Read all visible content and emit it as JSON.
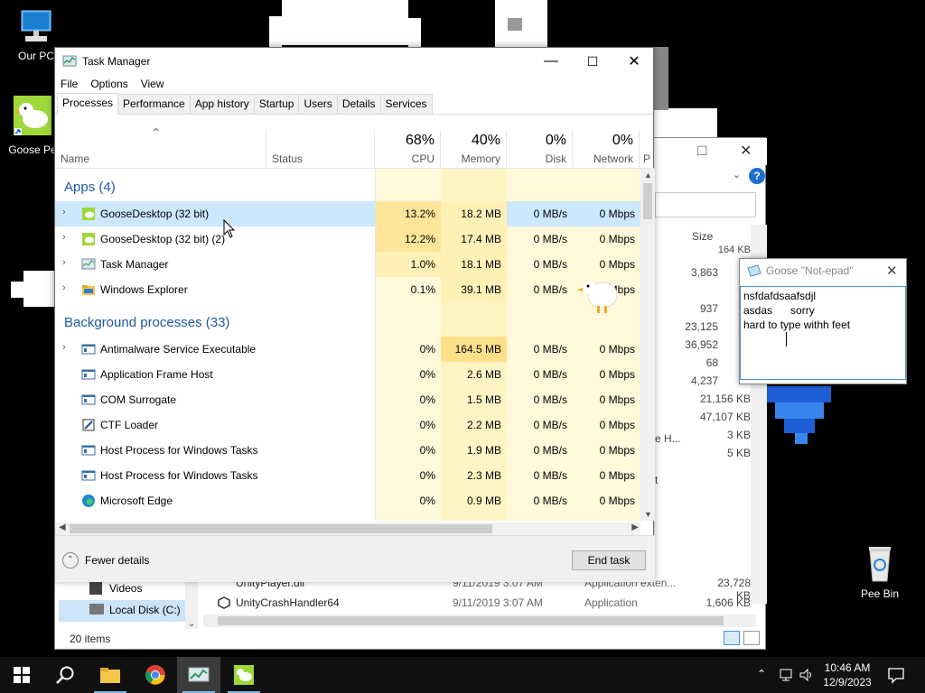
{
  "desktop": {
    "icons": [
      {
        "label": "Our PC"
      },
      {
        "label": "Goose Pe"
      },
      {
        "label": "Pee Bin"
      }
    ]
  },
  "explorer": {
    "size_header": "Size",
    "sizes": [
      "164 KB",
      "3,863",
      "937",
      "23,125",
      "36,952",
      "68",
      "4,237",
      "21,156 KB",
      "47,107 KB",
      "3 KB",
      "5 KB"
    ],
    "partial_texts": [
      "e H...",
      "t"
    ],
    "nav": [
      {
        "label": "Videos"
      },
      {
        "label": "Local Disk (C:)"
      }
    ],
    "files": [
      {
        "name": "UnityPlayer.dll",
        "date": "9/11/2019 3:07 AM",
        "type": "Application exten...",
        "size": "23,728 KB"
      },
      {
        "name": "UnityCrashHandler64",
        "date": "9/11/2019 3:07 AM",
        "type": "Application",
        "size": "1,606 KB"
      }
    ],
    "status": "20 items"
  },
  "taskmanager": {
    "title": "Task Manager",
    "menu": [
      "File",
      "Options",
      "View"
    ],
    "tabs": [
      "Processes",
      "Performance",
      "App history",
      "Startup",
      "Users",
      "Details",
      "Services"
    ],
    "columns": {
      "name": "Name",
      "status": "Status",
      "cpu": {
        "pct": "68%",
        "label": "CPU"
      },
      "memory": {
        "pct": "40%",
        "label": "Memory"
      },
      "disk": {
        "pct": "0%",
        "label": "Disk"
      },
      "network": {
        "pct": "0%",
        "label": "Network"
      },
      "extra": "P"
    },
    "apps_header": "Apps (4)",
    "apps": [
      {
        "name": "GooseDesktop (32 bit)",
        "cpu": "13.2%",
        "mem": "18.2 MB",
        "disk": "0 MB/s",
        "net": "0 Mbps"
      },
      {
        "name": "GooseDesktop (32 bit) (2)",
        "cpu": "12.2%",
        "mem": "17.4 MB",
        "disk": "0 MB/s",
        "net": "0 Mbps"
      },
      {
        "name": "Task Manager",
        "cpu": "1.0%",
        "mem": "18.1 MB",
        "disk": "0 MB/s",
        "net": "0 Mbps"
      },
      {
        "name": "Windows Explorer",
        "cpu": "0.1%",
        "mem": "39.1 MB",
        "disk": "0 MB/s",
        "net": "0 Mbps"
      }
    ],
    "bg_header": "Background processes (33)",
    "background": [
      {
        "name": "Antimalware Service Executable",
        "cpu": "0%",
        "mem": "164.5 MB",
        "disk": "0 MB/s",
        "net": "0 Mbps"
      },
      {
        "name": "Application Frame Host",
        "cpu": "0%",
        "mem": "2.6 MB",
        "disk": "0 MB/s",
        "net": "0 Mbps"
      },
      {
        "name": "COM Surrogate",
        "cpu": "0%",
        "mem": "1.5 MB",
        "disk": "0 MB/s",
        "net": "0 Mbps"
      },
      {
        "name": "CTF Loader",
        "cpu": "0%",
        "mem": "2.2 MB",
        "disk": "0 MB/s",
        "net": "0 Mbps"
      },
      {
        "name": "Host Process for Windows Tasks",
        "cpu": "0%",
        "mem": "1.9 MB",
        "disk": "0 MB/s",
        "net": "0 Mbps"
      },
      {
        "name": "Host Process for Windows Tasks",
        "cpu": "0%",
        "mem": "2.3 MB",
        "disk": "0 MB/s",
        "net": "0 Mbps"
      },
      {
        "name": "Microsoft Edge",
        "cpu": "0%",
        "mem": "0.9 MB",
        "disk": "0 MB/s",
        "net": "0 Mbps"
      }
    ],
    "fewer_details": "Fewer details",
    "end_task": "End task"
  },
  "notepad": {
    "title": "Goose \"Not-epad\"",
    "lines": [
      "nsfdafdsaafsdjl",
      "asdas      sorry",
      "hard to type withh feet"
    ]
  },
  "taskbar": {
    "time": "10:46 AM",
    "date": "12/9/2023"
  }
}
